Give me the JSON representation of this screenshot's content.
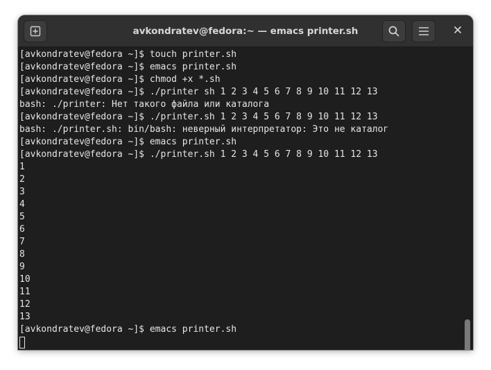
{
  "window": {
    "title": "avkondratev@fedora:~ — emacs printer.sh"
  },
  "headerbar": {
    "new_tab_icon": "new-tab-icon",
    "search_icon": "search-icon",
    "menu_icon": "hamburger-menu-icon",
    "close_icon": "close-icon"
  },
  "colors": {
    "terminal_bg": "#1e1e1e",
    "headerbar_bg": "#303030",
    "text": "#e6e6e6"
  },
  "terminal": {
    "lines": [
      "[avkondratev@fedora ~]$ touch printer.sh",
      "[avkondratev@fedora ~]$ emacs printer.sh",
      "[avkondratev@fedora ~]$ chmod +x *.sh",
      "[avkondratev@fedora ~]$ ./printer sh 1 2 3 4 5 6 7 8 9 10 11 12 13",
      "bash: ./printer: Нет такого файла или каталога",
      "[avkondratev@fedora ~]$ ./printer.sh 1 2 3 4 5 6 7 8 9 10 11 12 13",
      "bash: ./printer.sh: bin/bash: неверный интерпретатор: Это не каталог",
      "[avkondratev@fedora ~]$ emacs printer.sh",
      "[avkondratev@fedora ~]$ ./printer.sh 1 2 3 4 5 6 7 8 9 10 11 12 13",
      "1",
      "2",
      "3",
      "4",
      "5",
      "6",
      "7",
      "8",
      "9",
      "10",
      "11",
      "12",
      "13",
      "[avkondratev@fedora ~]$ emacs printer.sh"
    ]
  }
}
